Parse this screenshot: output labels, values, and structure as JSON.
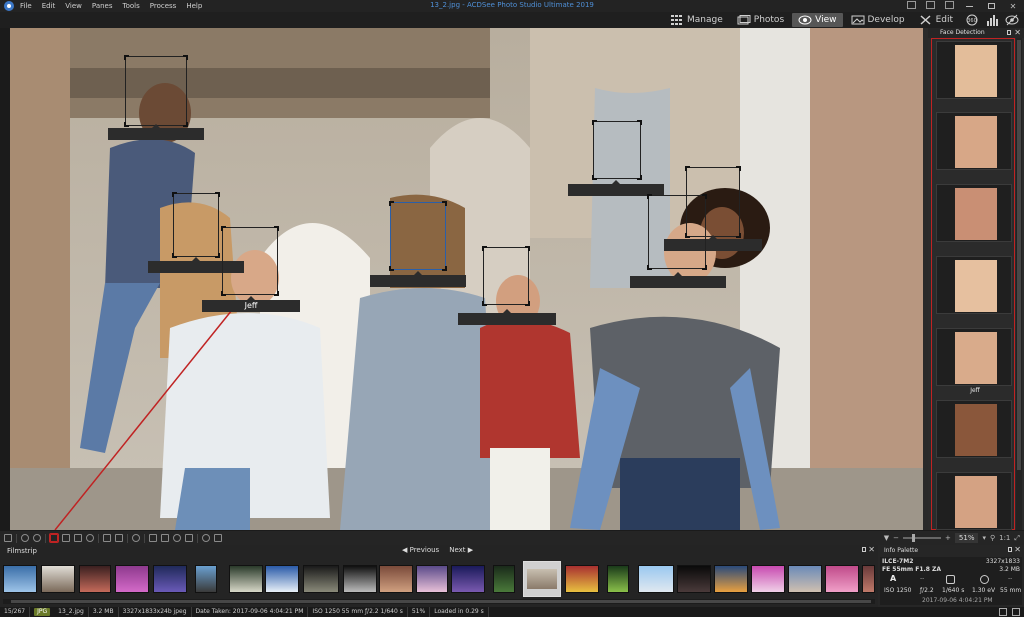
{
  "menu": [
    "File",
    "Edit",
    "View",
    "Panes",
    "Tools",
    "Process",
    "Help"
  ],
  "window_title": "13_2.jpg - ACDSee Photo Studio Ultimate 2019",
  "modes": {
    "manage": "Manage",
    "photos": "Photos",
    "view": "View",
    "develop": "Develop",
    "edit": "Edit",
    "active": "View",
    "extra_icons": [
      "360-icon",
      "histogram-icon",
      "eye-icon"
    ]
  },
  "viewer": {
    "faces": [
      {
        "label": "",
        "selected": false
      },
      {
        "label": "",
        "selected": false
      },
      {
        "label": "Jeff",
        "selected": false
      },
      {
        "label": "",
        "selected": true
      },
      {
        "label": "",
        "selected": false
      },
      {
        "label": "",
        "selected": false
      },
      {
        "label": "",
        "selected": false
      },
      {
        "label": "",
        "selected": false
      }
    ]
  },
  "face_pane": {
    "title": "Face Detection",
    "items": [
      {
        "name": ""
      },
      {
        "name": ""
      },
      {
        "name": ""
      },
      {
        "name": ""
      },
      {
        "name": "Jeff"
      },
      {
        "name": ""
      },
      {
        "name": ""
      }
    ]
  },
  "toolbar": {
    "zoom_value": "51%",
    "zoom_fit": "1:1",
    "accent_color": "#c02323"
  },
  "filmstrip": {
    "title": "Filmstrip",
    "previous": "Previous",
    "next": "Next"
  },
  "info_palette": {
    "title": "Info Palette",
    "camera": "ILCE-7M2",
    "lens": "FE 55mm F1.8 ZA",
    "dimensions": "3327x1833",
    "size": "3.2 MB",
    "mode": "A",
    "iso": "ISO 1250",
    "aperture": "ƒ/2.2",
    "shutter": "1/640 s",
    "exposure": "1.30 eV",
    "focal": "55 mm",
    "dash1": "--",
    "dash2": "--",
    "date": "2017-09-06 4:04:21 PM"
  },
  "status": {
    "position": "15/267",
    "badge": "JPG",
    "filename": "13_2.jpg",
    "filesize": "3.2 MB",
    "dims": "3327x1833x24b jpeg",
    "date_taken": "Date Taken: 2017-09-06 4:04:21 PM",
    "exif": "ISO 1250   55 mm   ƒ/2.2   1/640 s",
    "zoom": "51%",
    "loaded": "Loaded in 0.29 s"
  }
}
